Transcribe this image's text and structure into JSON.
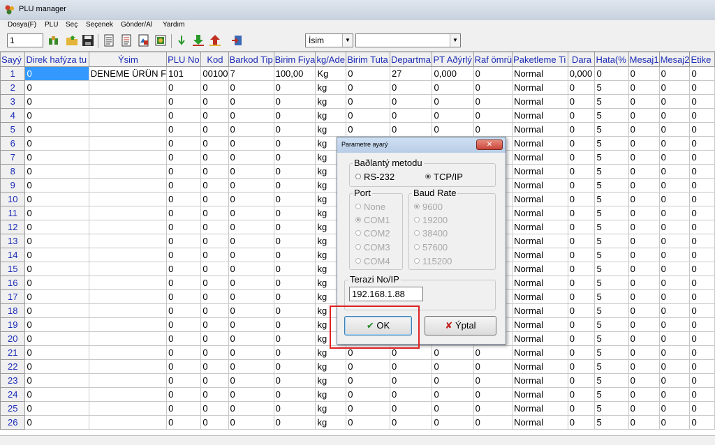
{
  "window": {
    "title": "PLU manager"
  },
  "menu": [
    "Dosya(F)",
    "PLU",
    "Seç",
    "Seçenek",
    "Gönder/Al",
    "Yardım"
  ],
  "toolbar": {
    "record_value": "1",
    "field_combo": "İsim",
    "search_combo": ""
  },
  "grid": {
    "columns": [
      "Sayý",
      "Direk hafýza tu",
      "Ýsim",
      "PLU No",
      "Kod",
      "Barkod Tip",
      "Birim Fiya",
      "kg/Ade",
      "Birim Tuta",
      "Departma",
      "PT Aðýrlý",
      "Raf ömrü",
      "Paketleme Ti",
      "Dara",
      "Hata(%",
      "Mesaj1",
      "Mesaj2",
      "Etike"
    ],
    "first_row": [
      "1",
      "0",
      "DENEME ÜRÜN F",
      "101",
      "00100",
      "7",
      "100,00",
      "Kg",
      "0",
      "27",
      "0,000",
      "0",
      "Normal",
      "0,000",
      "0",
      "0",
      "0",
      "0"
    ],
    "row_numbers": [
      "2",
      "3",
      "4",
      "5",
      "6",
      "7",
      "8",
      "9",
      "10",
      "11",
      "12",
      "13",
      "14",
      "15",
      "16",
      "17",
      "18",
      "19",
      "20",
      "21",
      "22",
      "23",
      "24",
      "25",
      "26"
    ],
    "default_row": [
      "0",
      "",
      "0",
      "0",
      "0",
      "0",
      "kg",
      "0",
      "0",
      "0",
      "0",
      "Normal",
      "0",
      "5",
      "0",
      "0",
      "0"
    ]
  },
  "dialog": {
    "title": "Parametre ayarý",
    "close_glyph": "✕",
    "connection_group": "Baðlantý metodu",
    "connection_options": [
      "RS-232",
      "TCP/IP"
    ],
    "connection_selected": "TCP/IP",
    "port_group": "Port",
    "port_options": [
      "None",
      "COM1",
      "COM2",
      "COM3",
      "COM4"
    ],
    "port_selected": "COM1",
    "baud_group": "Baud Rate",
    "baud_options": [
      "9600",
      "19200",
      "38400",
      "57600",
      "115200"
    ],
    "baud_selected": "9600",
    "scale_group": "Terazi  No/IP",
    "scale_ip": "192.168.1.88",
    "ok_label": "OK",
    "cancel_label": "Ýptal"
  },
  "colors": {
    "header_text": "#1a2bb5",
    "selection": "#3399ff",
    "highlight": "#e02020"
  }
}
